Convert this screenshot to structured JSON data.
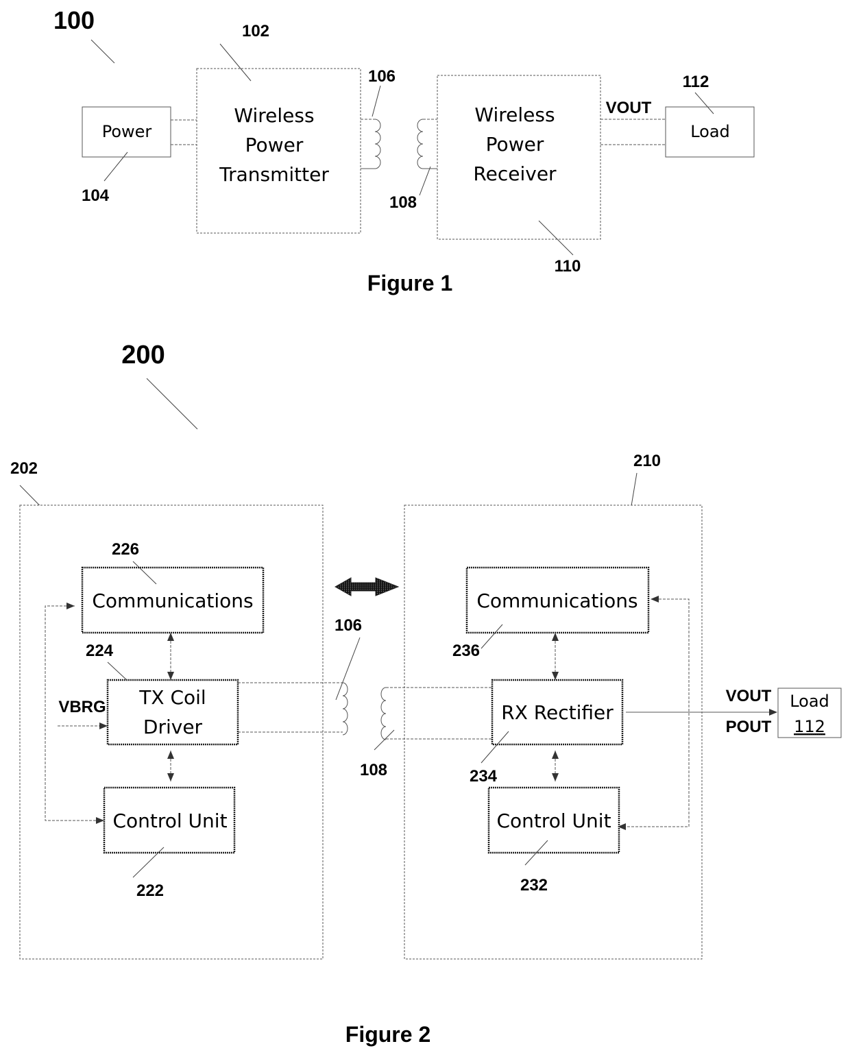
{
  "figure1": {
    "caption": "Figure 1",
    "system_ref": "100",
    "power": {
      "label": "Power",
      "ref": "104"
    },
    "transmitter": {
      "lines": [
        "Wireless",
        "Power",
        "Transmitter"
      ],
      "ref": "102"
    },
    "tx_coil": {
      "ref": "106"
    },
    "rx_coil": {
      "ref": "108"
    },
    "receiver": {
      "lines": [
        "Wireless",
        "Power",
        "Receiver"
      ],
      "ref": "110"
    },
    "vout_label": "VOUT",
    "load": {
      "label": "Load",
      "ref": "112"
    }
  },
  "figure2": {
    "caption": "Figure 2",
    "system_ref": "200",
    "transmitter_ref": "202",
    "receiver_ref": "210",
    "tx_comm": {
      "label": "Communications",
      "ref": "226"
    },
    "tx_driver": {
      "lines": [
        "TX Coil",
        "Driver"
      ],
      "ref": "224"
    },
    "tx_control": {
      "label": "Control Unit",
      "ref": "222"
    },
    "vbrg_label": "VBRG",
    "tx_coil_ref": "106",
    "rx_coil_ref": "108",
    "rx_comm": {
      "label": "Communications",
      "ref": "236"
    },
    "rx_rectifier": {
      "label": "RX Rectifier",
      "ref": "234"
    },
    "rx_control": {
      "label": "Control Unit",
      "ref": "232"
    },
    "vout_label": "VOUT",
    "pout_label": "POUT",
    "load": {
      "label": "Load",
      "ref": "112"
    }
  }
}
